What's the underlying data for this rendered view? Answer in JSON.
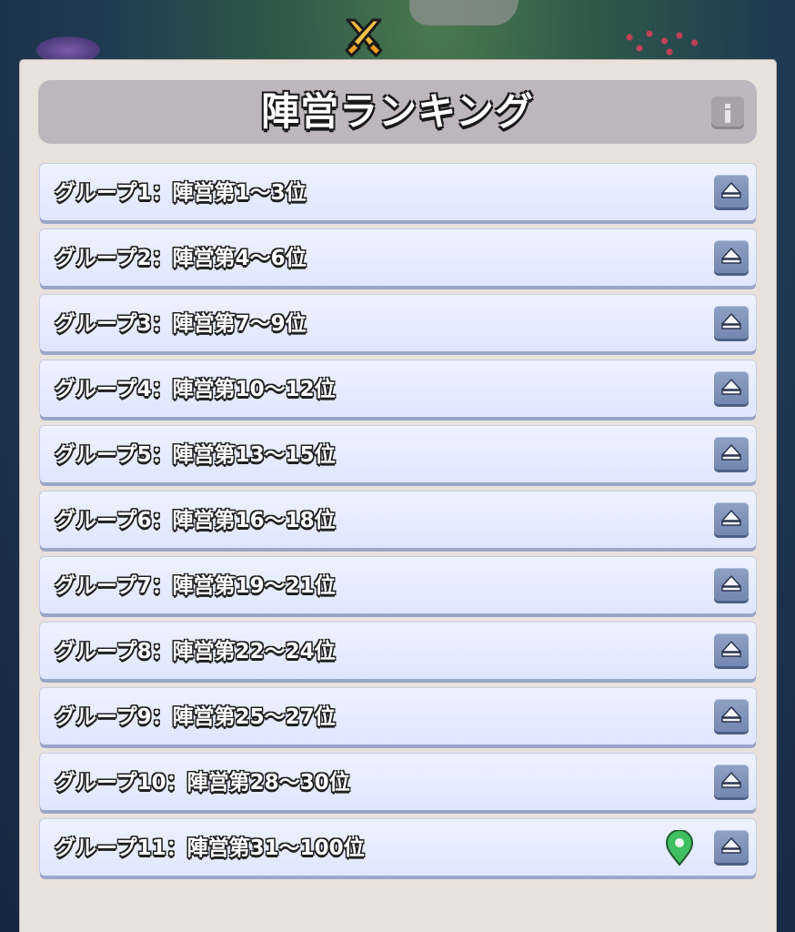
{
  "header": {
    "title": "陣営ランキング",
    "info_icon": "info-icon",
    "emblem_icon": "crossed-swords-icon"
  },
  "groups": [
    {
      "label": "グループ1：陣営第1〜3位",
      "expanded": false,
      "is_own_group": false
    },
    {
      "label": "グループ2：陣営第4〜6位",
      "expanded": false,
      "is_own_group": false
    },
    {
      "label": "グループ3：陣営第7〜9位",
      "expanded": false,
      "is_own_group": false
    },
    {
      "label": "グループ4：陣営第10〜12位",
      "expanded": false,
      "is_own_group": false
    },
    {
      "label": "グループ5：陣営第13〜15位",
      "expanded": false,
      "is_own_group": false
    },
    {
      "label": "グループ6：陣営第16〜18位",
      "expanded": false,
      "is_own_group": false
    },
    {
      "label": "グループ7：陣営第19〜21位",
      "expanded": false,
      "is_own_group": false
    },
    {
      "label": "グループ8：陣営第22〜24位",
      "expanded": false,
      "is_own_group": false
    },
    {
      "label": "グループ9：陣営第25〜27位",
      "expanded": false,
      "is_own_group": false
    },
    {
      "label": "グループ10：陣営第28〜30位",
      "expanded": false,
      "is_own_group": false
    },
    {
      "label": "グループ11：陣営第31〜100位",
      "expanded": false,
      "is_own_group": true
    }
  ],
  "colors": {
    "panel": "#e9e1dc",
    "title_bar": "#bdb6bc",
    "row": "#e4eaff",
    "toggle": "#8193bb",
    "pin": "#3fbf5f"
  }
}
